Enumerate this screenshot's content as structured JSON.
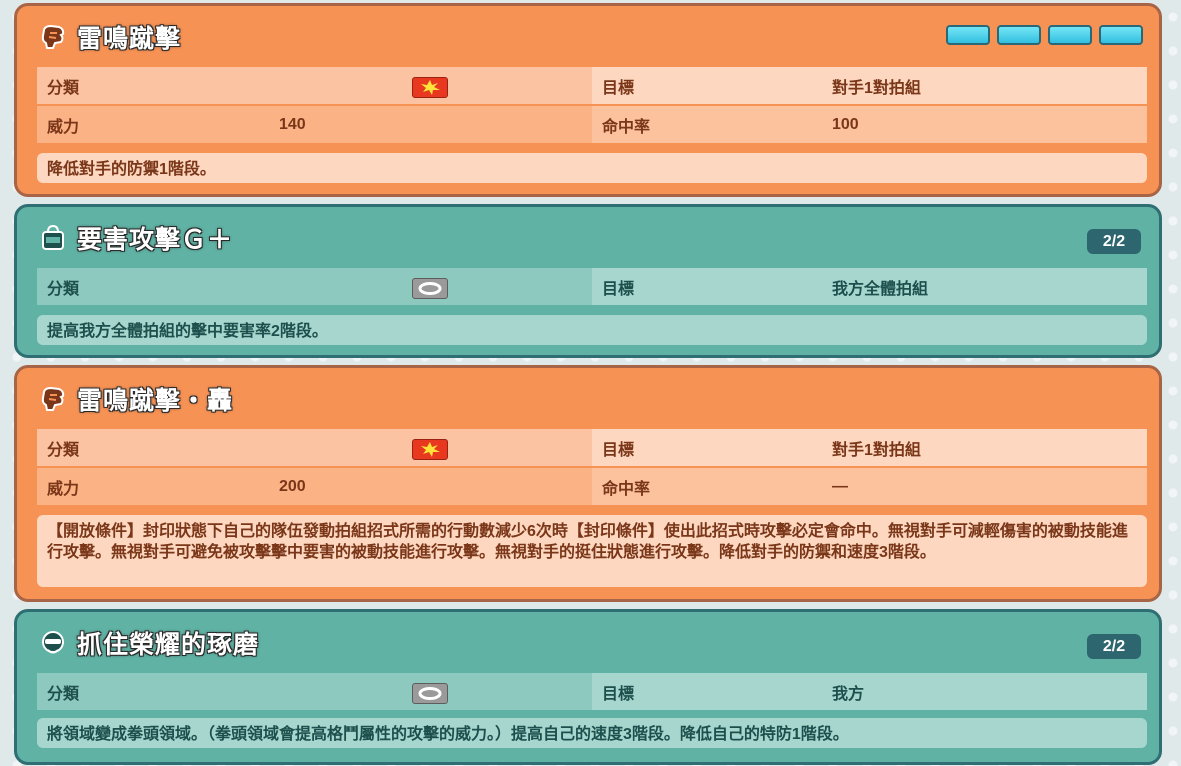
{
  "colors": {
    "physical": "#e8381f",
    "status": "#9a9a9a",
    "orange_card": "#f79255",
    "teal_card": "#5fb2a4"
  },
  "labels": {
    "category": "分類",
    "target": "目標",
    "power": "威力",
    "accuracy": "命中率"
  },
  "moves": [
    {
      "name": "雷鳴蹴擊",
      "icon": "fist-icon",
      "category_icon": "physical-icon",
      "target": "對手1對拍組",
      "power": "140",
      "accuracy": "100",
      "pp_bars": 4,
      "description": "降低對手的防禦1階段。"
    },
    {
      "name": "要害攻擊Ｇ＋",
      "icon": "bag-icon",
      "category_icon": "status-icon",
      "target": "我方全體拍組",
      "badge": "2/2",
      "description": "提高我方全體拍組的擊中要害率2階段。"
    },
    {
      "name": "雷鳴蹴擊・轟",
      "icon": "fist-icon",
      "category_icon": "physical-icon",
      "target": "對手1對拍組",
      "power": "200",
      "accuracy": "—",
      "description": "【開放條件】封印狀態下自己的隊伍發動拍組招式所需的行動數減少6次時【封印條件】使出此招式時攻擊必定會命中。無視對手可減輕傷害的被動技能進行攻擊。無視對手可避免被攻擊擊中要害的被動技能進行攻擊。無視對手的挺住狀態進行攻擊。降低對手的防禦和速度3階段。"
    },
    {
      "name": "抓住榮耀的琢磨",
      "icon": "mask-icon",
      "category_icon": "status-icon",
      "target": "我方",
      "badge": "2/2",
      "description": "將領域變成拳頭領域。（拳頭領域會提高格鬥屬性的攻擊的威力。）提高自己的速度3階段。降低自己的特防1階段。"
    }
  ]
}
